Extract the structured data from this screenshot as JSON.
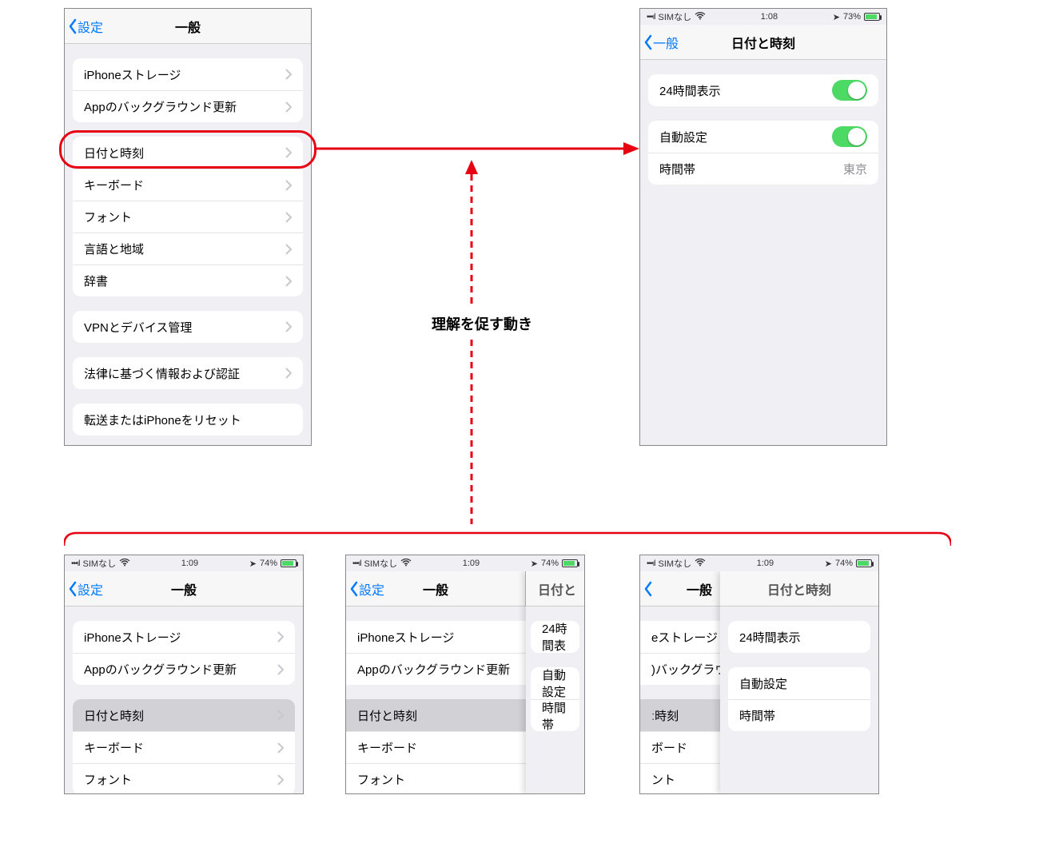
{
  "annotation": {
    "motion_label": "理解を促す動き"
  },
  "screen_general": {
    "back_label": "設定",
    "title": "一般",
    "groups": [
      {
        "rows": [
          {
            "label": "iPhoneストレージ",
            "chev": true
          },
          {
            "label": "Appのバックグラウンド更新",
            "chev": true
          }
        ]
      },
      {
        "rows": [
          {
            "label": "日付と時刻",
            "chev": true
          },
          {
            "label": "キーボード",
            "chev": true
          },
          {
            "label": "フォント",
            "chev": true
          },
          {
            "label": "言語と地域",
            "chev": true
          },
          {
            "label": "辞書",
            "chev": true
          }
        ]
      },
      {
        "rows": [
          {
            "label": "VPNとデバイス管理",
            "chev": true
          }
        ]
      },
      {
        "rows": [
          {
            "label": "法律に基づく情報および認証",
            "chev": true
          }
        ]
      },
      {
        "rows": [
          {
            "label": "転送またはiPhoneをリセット",
            "chev": true
          }
        ]
      }
    ]
  },
  "screen_datetime": {
    "status": {
      "carrier": "SIMなし",
      "time": "1:08",
      "battery": "73%"
    },
    "back_label": "一般",
    "title": "日付と時刻",
    "row_24h": "24時間表示",
    "row_auto": "自動設定",
    "row_tz_label": "時間帯",
    "row_tz_value": "東京"
  },
  "transitions": {
    "status": {
      "carrier": "SIMなし",
      "time": "1:09",
      "battery": "74%"
    },
    "general_back": "設定",
    "general_title": "一般",
    "dt_title": "日付と時刻",
    "dt_back": "一般",
    "g_rows_top": [
      "iPhoneストレージ",
      "Appのバックグラウンド更新"
    ],
    "g_rows_mid": [
      "日付と時刻",
      "キーボード",
      "フォント"
    ],
    "dt_rows": [
      "24時間表示",
      "自動設定",
      "時間帯"
    ],
    "frame2": {
      "dt_title_clip": "日付と",
      "dt_24h_clip": "24時間表",
      "dt_auto_clip": "自動設定",
      "dt_tz_clip": "時間帯"
    },
    "frame3": {
      "g_storage_clip": "eストレージ",
      "g_bg_clip": ")バックグラウント",
      "g_dt_clip": "ː時刻",
      "g_kb_clip": "ボード",
      "g_font_clip": "ント"
    }
  }
}
